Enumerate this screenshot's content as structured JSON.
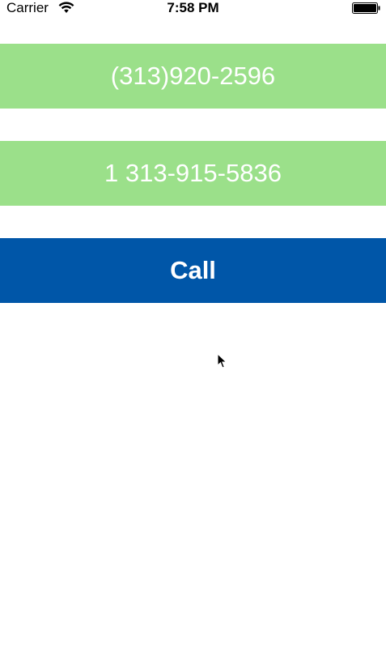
{
  "status_bar": {
    "carrier": "Carrier",
    "time": "7:58 PM",
    "wifi_icon": "wifi-icon",
    "battery_icon": "battery-full-icon"
  },
  "buttons": {
    "phone_1": "(313)920-2596",
    "phone_2": "1 313-915-5836",
    "call": "Call"
  },
  "colors": {
    "phone_button_bg": "#9be08a",
    "call_button_bg": "#0056a8",
    "button_text": "#ffffff"
  }
}
